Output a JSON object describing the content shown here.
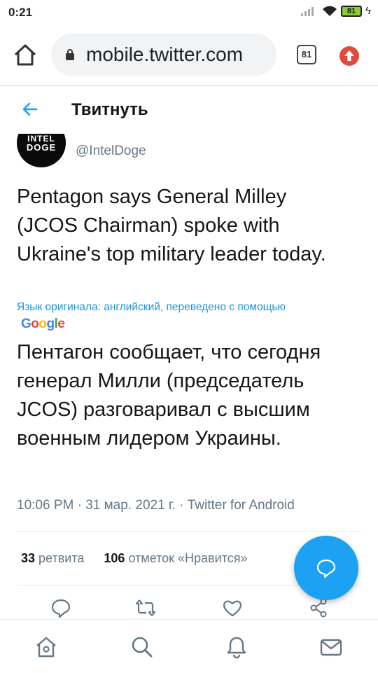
{
  "status_bar": {
    "time": "0:21",
    "battery": "81"
  },
  "browser": {
    "url": "mobile.twitter.com",
    "tab_count": "81"
  },
  "page_header": {
    "title": "Твитнуть"
  },
  "tweet": {
    "author_handle": "@IntelDoge",
    "avatar_text_line1": "INTEL",
    "avatar_text_line2": "DOGE",
    "text_original": "Pentagon says General Milley (JCOS Chairman) spoke with Ukraine's top military leader today.",
    "translation_note": "Язык оригинала: английский, переведено с помощью",
    "translation_provider": "Google",
    "text_translated": "Пентагон сообщает, что сегодня генерал Милли (председатель JCOS) разговаривал с высшим военным лидером Украины.",
    "timestamp": "10:06 PM · 31 мар. 2021 г. · Twitter for Android",
    "retweets_count": "33",
    "retweets_label": "ретвита",
    "likes_count": "106",
    "likes_label": "отметок «Нравится»"
  },
  "colors": {
    "accent": "#1da1f2",
    "link": "#1b95e0",
    "secondary_text": "#657786",
    "update_badge": "#e04a3f"
  },
  "icons": {
    "action_bar": [
      "reply-icon",
      "retweet-icon",
      "like-icon",
      "share-icon"
    ],
    "bottom_nav": [
      "home-icon",
      "search-icon",
      "notifications-icon",
      "messages-icon"
    ],
    "fab": "compose-reply-icon"
  }
}
